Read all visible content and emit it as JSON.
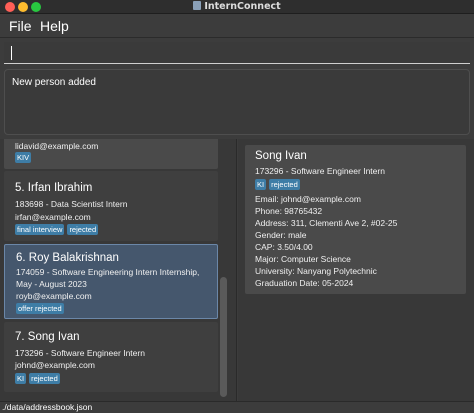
{
  "window": {
    "title": "InternConnect"
  },
  "menu": {
    "items": [
      "File",
      "Help"
    ]
  },
  "command": {
    "value": ""
  },
  "result": {
    "text": "New person added"
  },
  "list": [
    {
      "name": "",
      "email": "lidavid@example.com",
      "tags": [
        "KIV"
      ]
    },
    {
      "name": "5.  Irfan Ibrahim",
      "role": "183698 - Data Scientist Intern",
      "email": "irfan@example.com",
      "tags": [
        "final interview",
        "rejected"
      ]
    },
    {
      "name": "6.  Roy Balakrishnan",
      "role": "174059 - Software Engineering Intern Internship,",
      "role2": "May - August 2023",
      "email": "royb@example.com",
      "tags": [
        "offer rejected"
      ]
    },
    {
      "name": "7.  Song Ivan",
      "role": "173296 - Software Engineer Intern",
      "email": "johnd@example.com",
      "tags": [
        "KI",
        "rejected"
      ]
    }
  ],
  "detail": {
    "name": "Song Ivan",
    "role": "173296 - Software Engineer Intern",
    "tags": [
      "KI",
      "rejected"
    ],
    "lines": [
      "Email: johnd@example.com",
      "Phone: 98765432",
      "Address: 311, Clementi Ave 2, #02-25",
      "Gender: male",
      "CAP: 3.50/4.00",
      "Major: Computer Science",
      "University: Nanyang Polytechnic",
      "Graduation Date: 05-2024"
    ]
  },
  "status": {
    "path": "./data/addressbook.json"
  }
}
